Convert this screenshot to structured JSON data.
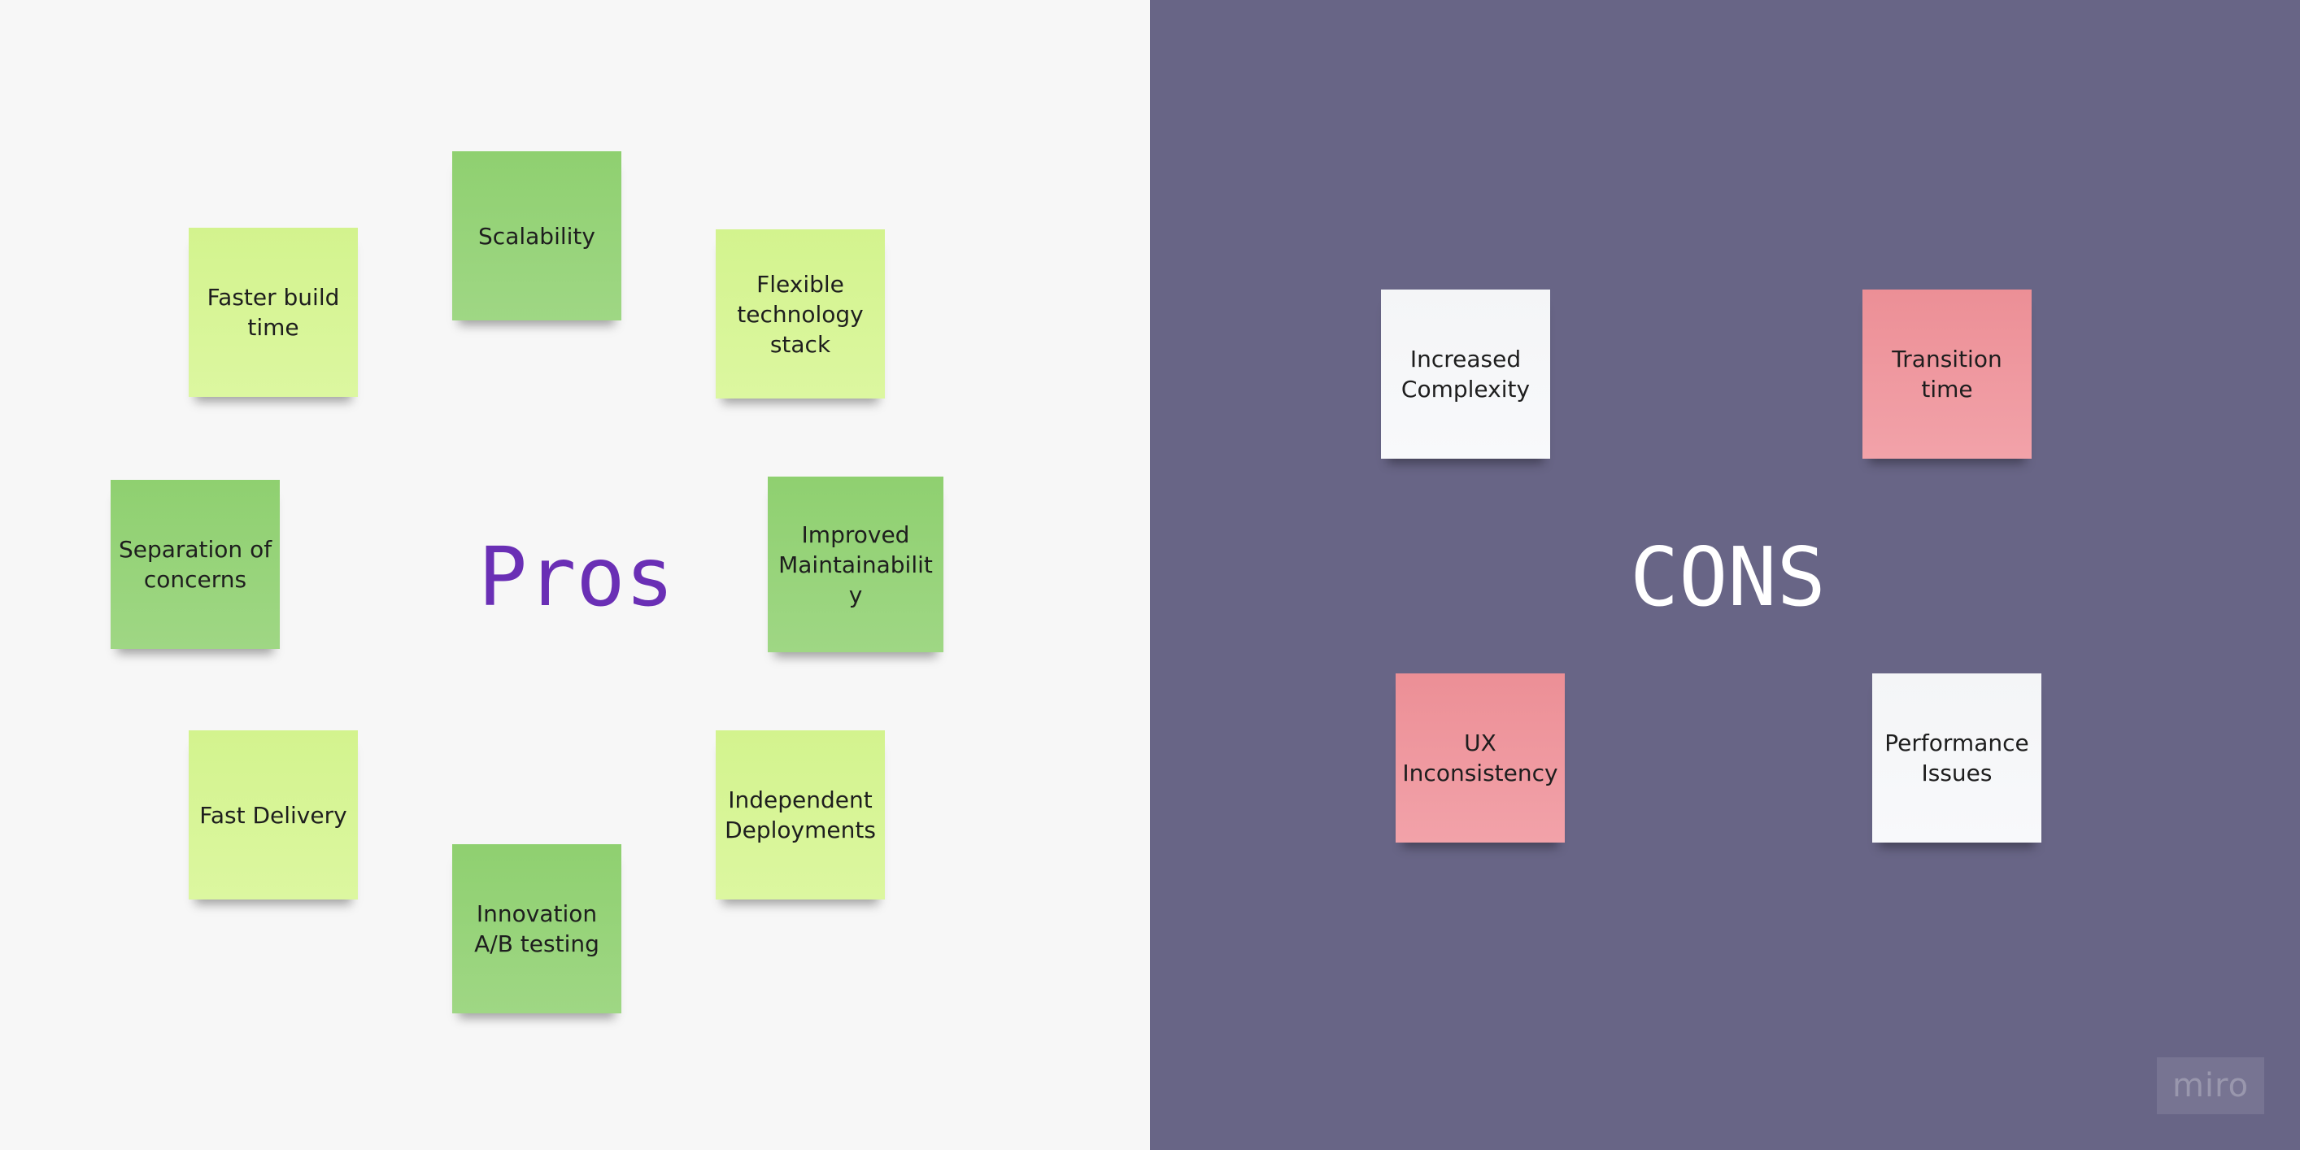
{
  "pros": {
    "heading": "Pros",
    "notes": [
      {
        "text": "Scalability",
        "color": "#94d27a"
      },
      {
        "text": "Faster build time",
        "color": "#d7f596"
      },
      {
        "text": "Flexible technology stack",
        "color": "#d7f596"
      },
      {
        "text": "Separation of concerns",
        "color": "#94d27a"
      },
      {
        "text": "Improved Maintainability",
        "color": "#94d27a"
      },
      {
        "text": "Fast Delivery",
        "color": "#d7f596"
      },
      {
        "text": "Independent Deployments",
        "color": "#d7f596"
      },
      {
        "text": "Innovation A/B testing",
        "color": "#94d27a"
      }
    ]
  },
  "cons": {
    "heading": "CONS",
    "notes": [
      {
        "text": "Increased Complexity",
        "color": "#f5f6f8"
      },
      {
        "text": "Transition time",
        "color": "#ef98a0"
      },
      {
        "text": "UX Inconsistency",
        "color": "#ef98a0"
      },
      {
        "text": "Performance Issues",
        "color": "#f5f6f8"
      }
    ]
  },
  "watermark": "miro",
  "colors": {
    "left_background": "#f7f7f7",
    "right_background": "#686586",
    "pros_heading": "#6a2fb5",
    "cons_heading": "#ffffff"
  }
}
